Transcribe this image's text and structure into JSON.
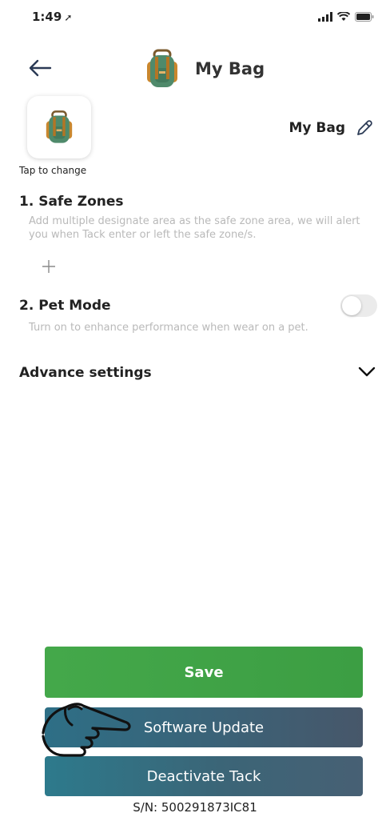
{
  "status_bar": {
    "time": "1:49",
    "location_glyph": "➚",
    "icons": [
      "signal-icon",
      "wifi-icon",
      "battery-icon"
    ]
  },
  "nav": {
    "title": "My Bag",
    "back_icon": "arrow-left-icon",
    "bag_icon": "backpack-icon"
  },
  "device": {
    "avatar_hint": "Tap to change",
    "name": "My Bag",
    "edit_icon": "pencil-icon"
  },
  "safe_zones": {
    "title": "1. Safe Zones",
    "description": "Add multiple designate area as the safe zone area, we will alert you when Tack enter or left the safe zone/s.",
    "add_icon": "plus-icon"
  },
  "pet_mode": {
    "title": "2. Pet Mode",
    "description": "Turn on to enhance performance when wear on a pet.",
    "enabled": false
  },
  "advance": {
    "label": "Advance settings",
    "icon": "chevron-down-icon"
  },
  "actions": {
    "save_label": "Save",
    "update_label": "Software Update",
    "deactivate_label": "Deactivate Tack"
  },
  "serial": "S/N: 500291873IC81",
  "colors": {
    "save": "#42a548",
    "update": "#3b6277",
    "deactivate": "#3b6577",
    "muted_text": "#b9b9b9",
    "bag_green": "#4f8a6b",
    "bag_orange": "#c9872e"
  }
}
